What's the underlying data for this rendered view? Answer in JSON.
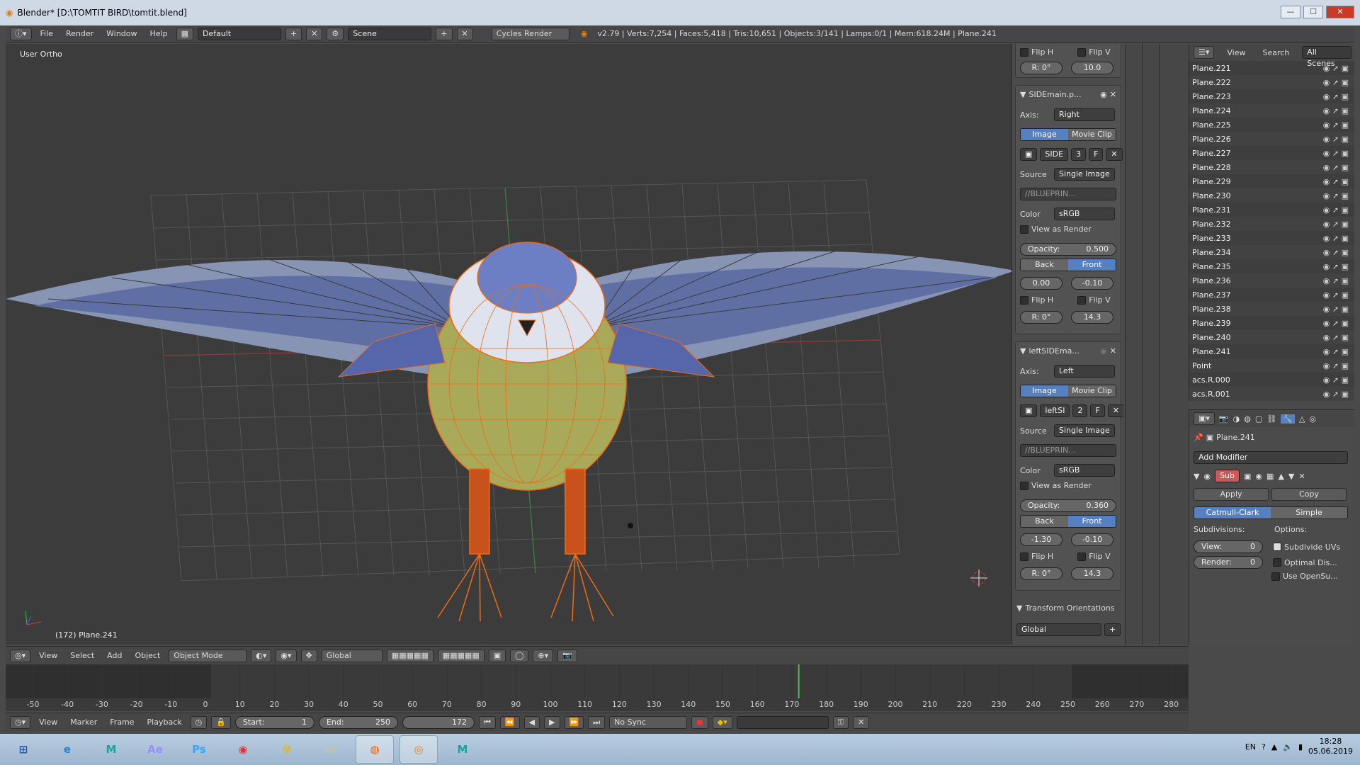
{
  "window": {
    "title": "Blender* [D:\\TOMTIT BIRD\\tomtit.blend]",
    "controls": [
      "—",
      "☐",
      "✕"
    ]
  },
  "info": {
    "menus": [
      "File",
      "Render",
      "Window",
      "Help"
    ],
    "layout": "Default",
    "scene": "Scene",
    "engine": "Cycles Render",
    "stats": "v2.79 | Verts:7,254 | Faces:5,418 | Tris:10,651 | Objects:3/141 | Lamps:0/1 | Mem:618.24M | Plane.241"
  },
  "viewport": {
    "view_label": "User Ortho",
    "object_label": "(172) Plane.241"
  },
  "npanel": {
    "top": {
      "flip_h": "Flip H",
      "flip_v": "Flip V",
      "rot": "R: 0°",
      "size": "10.0"
    },
    "panels": [
      {
        "name": "SIDEmain.p...",
        "axis_label": "Axis:",
        "axis": "Right",
        "tab_image": "Image",
        "tab_clip": "Movie Clip",
        "img_name": "SIDE",
        "img_users": "3",
        "img_f": "F",
        "source_label": "Source",
        "source": "Single Image",
        "filepath": "//BLUEPRIN...",
        "color_label": "Color",
        "color": "sRGB",
        "view_as_render": "View as Render",
        "opacity": "Opacity:",
        "opacity_val": "0.500",
        "back": "Back",
        "front": "Front",
        "x": "0.00",
        "y": "-0.10",
        "flip_h": "Flip H",
        "flip_v": "Flip V",
        "rot": "R: 0°",
        "size": "14.3"
      },
      {
        "name": "leftSIDEma...",
        "axis_label": "Axis:",
        "axis": "Left",
        "tab_image": "Image",
        "tab_clip": "Movie Clip",
        "img_name": "leftSI",
        "img_users": "2",
        "img_f": "F",
        "source_label": "Source",
        "source": "Single Image",
        "filepath": "//BLUEPRIN...",
        "color_label": "Color",
        "color": "sRGB",
        "view_as_render": "View as Render",
        "opacity": "Opacity:",
        "opacity_val": "0.360",
        "back": "Back",
        "front": "Front",
        "x": "-1.30",
        "y": "-0.10",
        "flip_h": "Flip H",
        "flip_v": "Flip V",
        "rot": "R: 0°",
        "size": "14.3"
      }
    ],
    "transform_orientations": "Transform Orientations",
    "orientation": "Global"
  },
  "outliner": {
    "header": {
      "view": "View",
      "search": "Search",
      "scenes": "All Scenes"
    },
    "items": [
      "Plane.221",
      "Plane.222",
      "Plane.223",
      "Plane.224",
      "Plane.225",
      "Plane.226",
      "Plane.227",
      "Plane.228",
      "Plane.229",
      "Plane.230",
      "Plane.231",
      "Plane.232",
      "Plane.233",
      "Plane.234",
      "Plane.235",
      "Plane.236",
      "Plane.237",
      "Plane.238",
      "Plane.239",
      "Plane.240",
      "Plane.241",
      "Point",
      "acs.R.000",
      "acs.R.001"
    ]
  },
  "properties": {
    "object": "Plane.241",
    "add_modifier": "Add Modifier",
    "modifier_name": "Sub",
    "apply": "Apply",
    "copy": "Copy",
    "catmull": "Catmull-Clark",
    "simple": "Simple",
    "subdivisions": "Subdivisions:",
    "options": "Options:",
    "view": "View:",
    "view_val": "0",
    "render": "Render:",
    "render_val": "0",
    "subdivide_uvs": "Subdivide UVs",
    "optimal": "Optimal Dis...",
    "opensubdiv": "Use OpenSu..."
  },
  "view3d_header": {
    "menus": [
      "View",
      "Select",
      "Add",
      "Object"
    ],
    "mode": "Object Mode",
    "orientation": "Global"
  },
  "timeline": {
    "ticks": [
      "-50",
      "-40",
      "-30",
      "-20",
      "-10",
      "0",
      "10",
      "20",
      "30",
      "40",
      "50",
      "60",
      "70",
      "80",
      "90",
      "100",
      "110",
      "120",
      "130",
      "140",
      "150",
      "160",
      "170",
      "180",
      "190",
      "200",
      "210",
      "220",
      "230",
      "240",
      "250",
      "260",
      "270",
      "280"
    ],
    "current_frame": 172,
    "menus": [
      "View",
      "Marker",
      "Frame",
      "Playback"
    ],
    "start_label": "Start:",
    "start": "1",
    "end_label": "End:",
    "end": "250",
    "frame": "172",
    "sync": "No Sync"
  },
  "taskbar": {
    "apps": [
      {
        "name": "start-icon",
        "glyph": "⊞",
        "color": "#1e5aa8"
      },
      {
        "name": "ie-icon",
        "glyph": "e",
        "color": "#2a7fd4"
      },
      {
        "name": "maya-icon",
        "glyph": "M",
        "color": "#1aa3a3"
      },
      {
        "name": "aftereffects-icon",
        "glyph": "Ae",
        "color": "#9a8cff"
      },
      {
        "name": "photoshop-icon",
        "glyph": "Ps",
        "color": "#31a8ff"
      },
      {
        "name": "app-red-icon",
        "glyph": "◉",
        "color": "#d33"
      },
      {
        "name": "app-radiation-icon",
        "glyph": "☢",
        "color": "#e6b800"
      },
      {
        "name": "explorer-icon",
        "glyph": "▭",
        "color": "#e8c45c"
      },
      {
        "name": "firefox-icon",
        "glyph": "◍",
        "color": "#e66000"
      },
      {
        "name": "blender-icon",
        "glyph": "◎",
        "color": "#e87d0d"
      },
      {
        "name": "maya2-icon",
        "glyph": "M",
        "color": "#1aa3a3"
      }
    ],
    "lang": "EN",
    "time": "18:28",
    "date": "05.06.2019"
  }
}
